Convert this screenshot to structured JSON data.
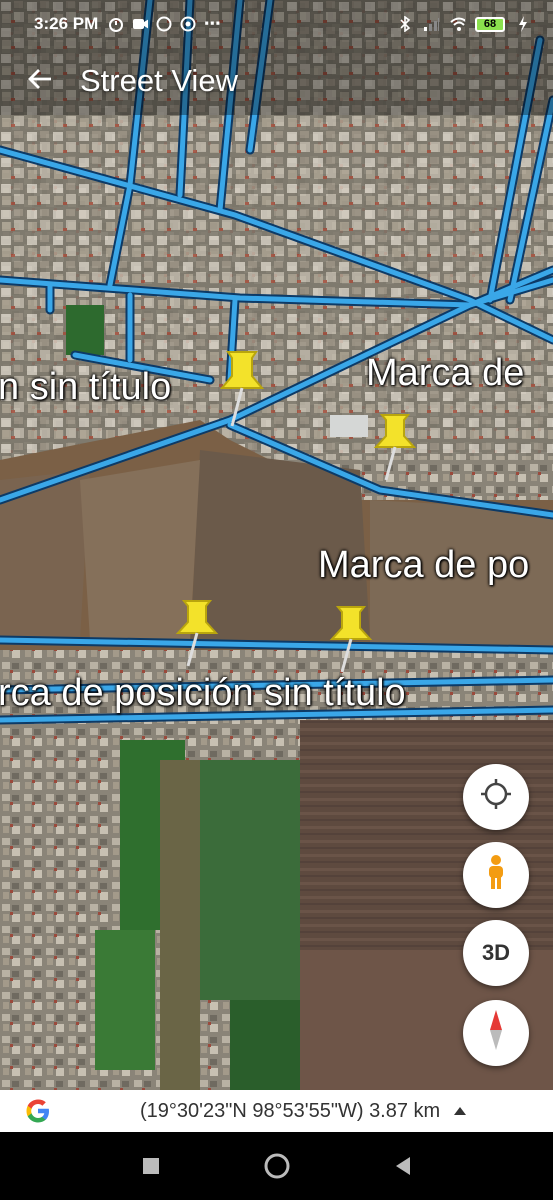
{
  "status_bar": {
    "time": "3:26 PM",
    "battery": "68",
    "icons_left": [
      "alarm-icon",
      "video-icon",
      "whatsapp-icon",
      "app-icon",
      "more-dots-icon"
    ],
    "icons_right": [
      "bluetooth-icon",
      "signal-icon",
      "wifi-icon",
      "battery-icon",
      "charging-icon"
    ]
  },
  "app_bar": {
    "title": "Street View",
    "back_icon": "arrow-back-icon"
  },
  "map": {
    "labels": {
      "label_1": "n sin título",
      "label_2": "Marca de",
      "label_3": "Marca de po",
      "label_4": "rca de posición sin título"
    },
    "pin_color": "#f3e22a",
    "road_color": "#3aa7e8"
  },
  "controls": {
    "my_location_icon": "crosshair-icon",
    "pegman_icon": "pegman-icon",
    "threed_label": "3D",
    "compass_icon": "compass-icon"
  },
  "bottom_bar": {
    "coords": "(19°30'23\"N 98°53'55\"W) 3.87 km",
    "logo_icon": "google-g-icon"
  },
  "nav_bar": {
    "icons": [
      "recent-apps-icon",
      "home-icon",
      "back-icon"
    ]
  }
}
